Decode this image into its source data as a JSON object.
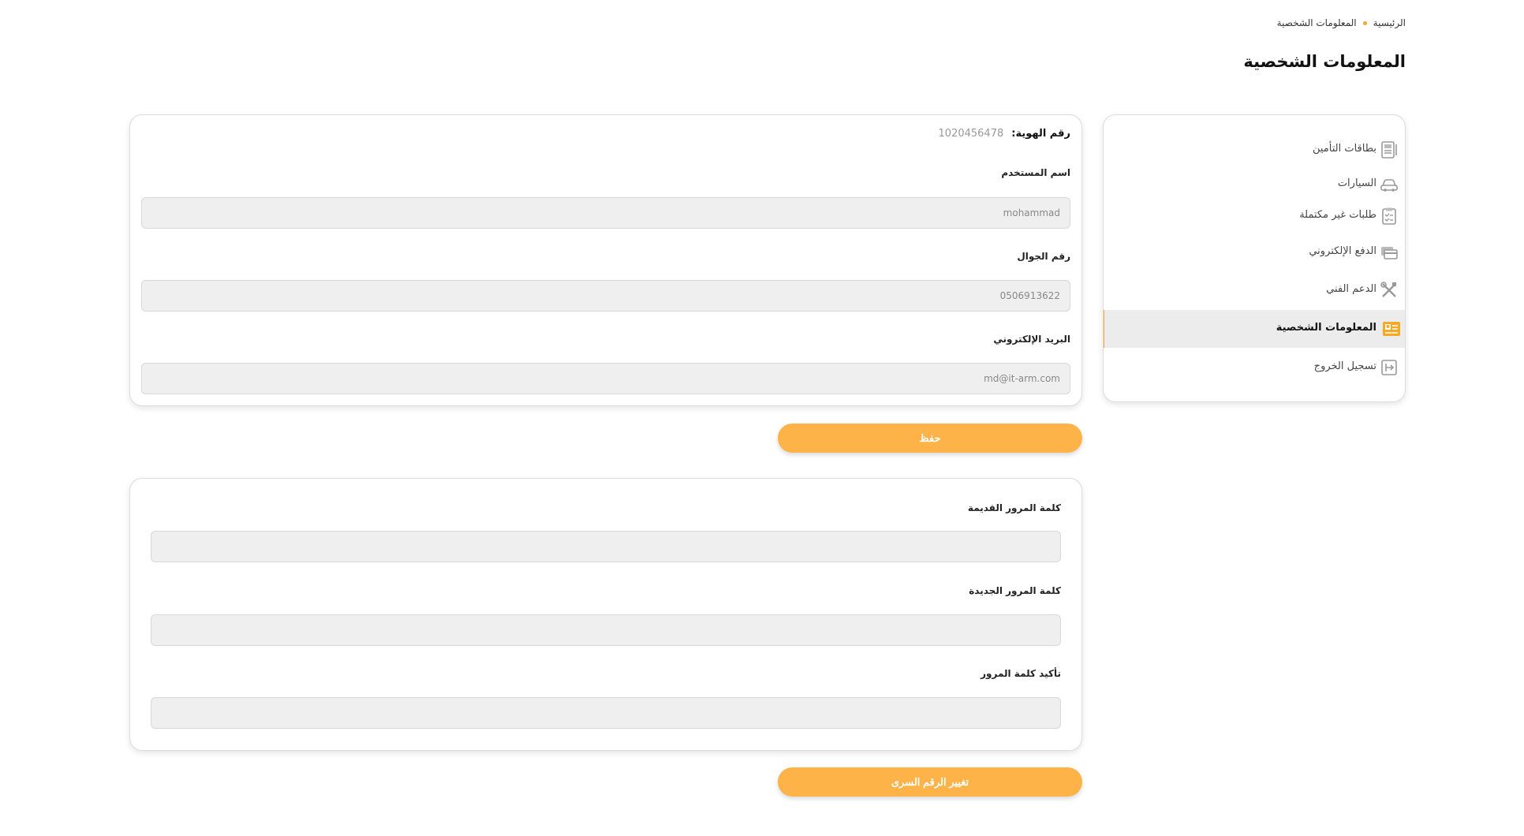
{
  "breadcrumb": {
    "home": "الرئيسية",
    "current": "المعلومات الشخصية"
  },
  "page": {
    "title": "المعلومات الشخصية"
  },
  "sidebar": {
    "accent_color": "#f6a827",
    "items": [
      {
        "label": "بطاقات التأمين",
        "icon": "id-card-icon",
        "active": false
      },
      {
        "label": "السيارات",
        "icon": "car-icon",
        "active": false
      },
      {
        "label": "طلبات غير مكتملة",
        "icon": "clipboard-icon",
        "active": false
      },
      {
        "label": "الدفع الإلكتروني",
        "icon": "payment-card-icon",
        "active": false
      },
      {
        "label": "الدعم الفني",
        "icon": "tools-icon",
        "active": false
      },
      {
        "label": "المعلومات الشخصية",
        "icon": "profile-card-icon",
        "active": true
      },
      {
        "label": "تسجيل الخروج",
        "icon": "logout-icon",
        "active": false
      }
    ]
  },
  "profile": {
    "id_label": "رقم الهوية:",
    "id_value": "1020456478",
    "username_label": "اسم المستخدم",
    "username_value": "mohammad",
    "mobile_label": "رقم الجوال",
    "mobile_value": "0506913622",
    "email_label": "البريد الإلكتروني",
    "email_value": "md@it-arm.com",
    "save_label": "حفظ"
  },
  "password": {
    "old_label": "كلمة المرور القديمة",
    "new_label": "كلمة المرور الجديدة",
    "confirm_label": "تأكيد كلمة المرور",
    "old_value": "",
    "new_value": "",
    "confirm_value": "",
    "change_label": "تغيير الرقم السرى"
  },
  "colors": {
    "button": "#fdb347",
    "field_bg": "#efefef"
  }
}
